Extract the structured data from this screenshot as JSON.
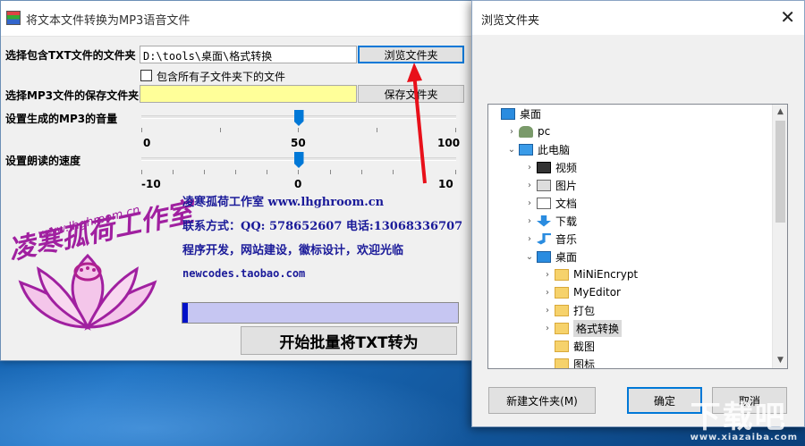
{
  "app": {
    "title": "将文本文件转换为MP3语音文件",
    "txt_folder_label": "选择包含TXT文件的文件夹",
    "txt_folder_value": "D:\\tools\\桌面\\格式转换",
    "browse_button": "浏览文件夹",
    "include_subfolders_label": "包含所有子文件夹下的文件",
    "include_subfolders_checked": false,
    "mp3_folder_label": "选择MP3文件的保存文件夹",
    "mp3_folder_value": "",
    "save_folder_button": "保存文件夹",
    "volume_label": "设置生成的MP3的音量",
    "volume_ticks": [
      "0",
      "50",
      "100"
    ],
    "volume_value": 50,
    "speed_label": "设置朗读的速度",
    "speed_ticks": [
      "-10",
      "0",
      "10"
    ],
    "speed_value": 0,
    "studio_line1": "凌寒孤荷工作室 www.lhghroom.cn",
    "studio_line2": "联系方式：QQ: 578652607 电话:13068336707",
    "studio_line3": "程序开发，网站建设，徽标设计，欢迎光临",
    "studio_line4": "newcodes.taobao.com",
    "logo_text": "凌寒孤荷工作室",
    "logo_url": "www.lhghroom.cn",
    "progress": 0.02,
    "start_button": "开始批量将TXT转为",
    "colors": {
      "mp3_field_bg": "#ffff99",
      "progress_bg": "#c6c6f2",
      "progress_fill": "#0010c8",
      "logo_purple": "#a020a0"
    }
  },
  "dialog": {
    "title": "浏览文件夹",
    "close_icon": "close-icon",
    "tree": [
      {
        "label": "桌面",
        "level": 0,
        "icon": "desktop-icon",
        "expanded": true
      },
      {
        "label": "pc",
        "level": 1,
        "icon": "user-icon",
        "expanded": false
      },
      {
        "label": "此电脑",
        "level": 1,
        "icon": "computer-icon",
        "expanded": true
      },
      {
        "label": "视频",
        "level": 2,
        "icon": "video-folder-icon",
        "expanded": false
      },
      {
        "label": "图片",
        "level": 2,
        "icon": "picture-folder-icon",
        "expanded": false
      },
      {
        "label": "文档",
        "level": 2,
        "icon": "document-folder-icon",
        "expanded": false
      },
      {
        "label": "下载",
        "level": 2,
        "icon": "download-folder-icon",
        "expanded": false
      },
      {
        "label": "音乐",
        "level": 2,
        "icon": "music-folder-icon",
        "expanded": false
      },
      {
        "label": "桌面",
        "level": 2,
        "icon": "desktop-icon",
        "expanded": true
      },
      {
        "label": "MiNiEncrypt",
        "level": 3,
        "icon": "folder-icon",
        "expanded": false
      },
      {
        "label": "MyEditor",
        "level": 3,
        "icon": "folder-icon",
        "expanded": false
      },
      {
        "label": "打包",
        "level": 3,
        "icon": "folder-icon",
        "expanded": false
      },
      {
        "label": "格式转换",
        "level": 3,
        "icon": "folder-icon",
        "expanded": false,
        "selected": true
      },
      {
        "label": "截图",
        "level": 3,
        "icon": "folder-icon",
        "expanded": null
      },
      {
        "label": "图标",
        "level": 3,
        "icon": "folder-icon",
        "expanded": null
      }
    ],
    "new_folder_button": "新建文件夹(M)",
    "ok_button": "确定",
    "cancel_button": "取消"
  },
  "watermark": {
    "text": "下载吧",
    "sub": "www.xiazaiba.com"
  }
}
